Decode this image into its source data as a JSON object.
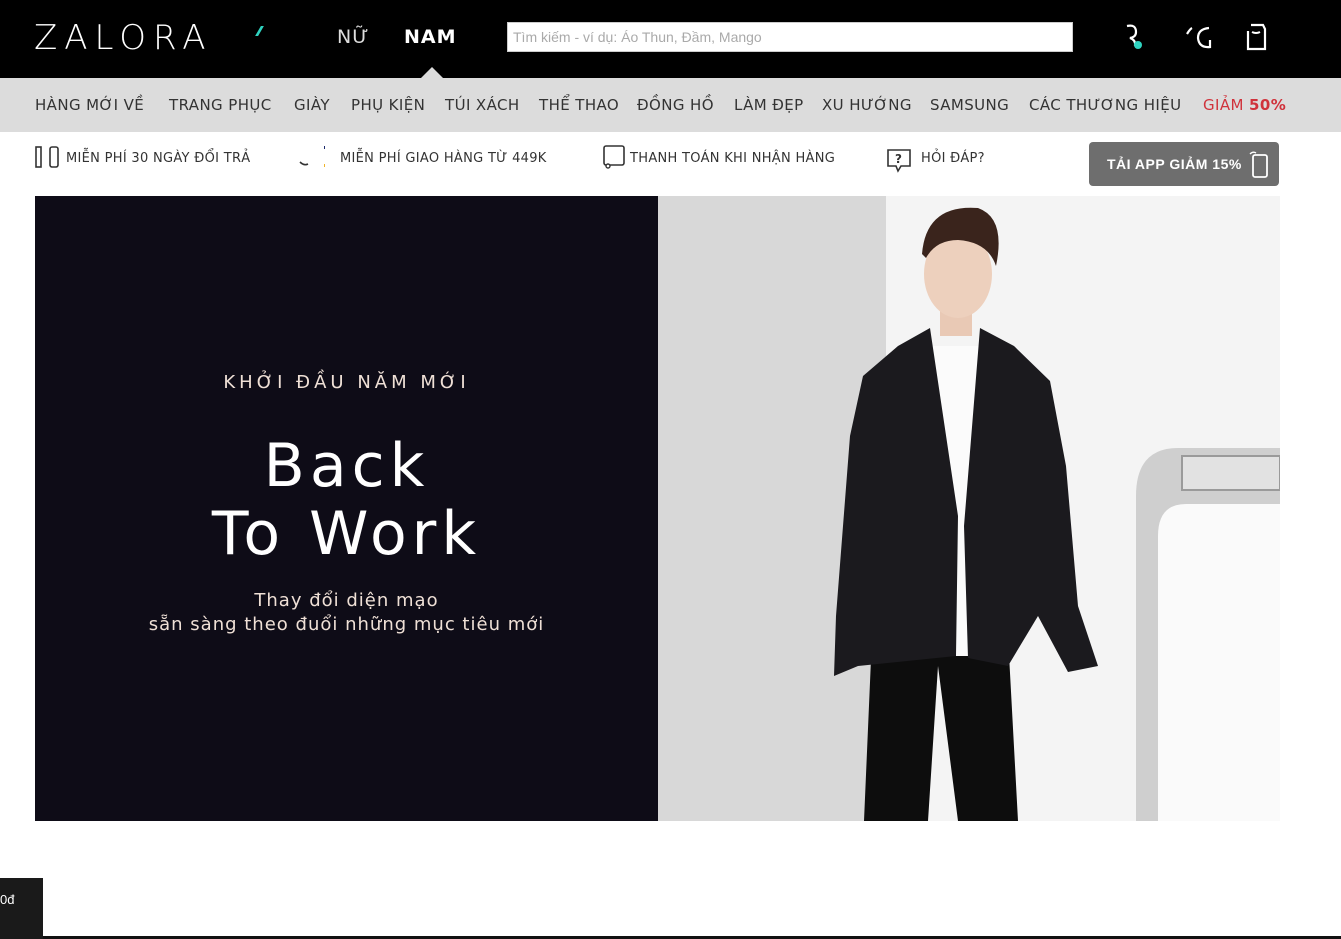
{
  "header": {
    "logo": "ZALORA",
    "gender_women": "NỮ",
    "gender_men": "NAM",
    "search_placeholder": "Tìm kiếm - ví dụ: Áo Thun, Đầm, Mango",
    "icons": [
      "account-icon",
      "wishlist-icon",
      "cart-icon"
    ]
  },
  "categories": [
    {
      "label": "HÀNG MỚI VỀ"
    },
    {
      "label": "TRANG PHỤC"
    },
    {
      "label": "GIÀY"
    },
    {
      "label": "PHỤ KIỆN"
    },
    {
      "label": "TÚI XÁCH"
    },
    {
      "label": "THỂ THAO"
    },
    {
      "label": "ĐỒNG HỒ"
    },
    {
      "label": "LÀM ĐẸP"
    },
    {
      "label": "XU HƯỚNG"
    },
    {
      "label": "SAMSUNG"
    },
    {
      "label": "CÁC THƯƠNG HIỆU"
    }
  ],
  "sale": {
    "label": "GIẢM",
    "value": "50%"
  },
  "services": [
    {
      "label": "MIỄN PHÍ 30 NGÀY ĐỔI TRẢ",
      "icon": "return-icon"
    },
    {
      "label": "MIỄN PHÍ GIAO HÀNG TỪ 449K",
      "icon": "shipping-icon"
    },
    {
      "label": "THANH TOÁN KHI NHẬN HÀNG",
      "icon": "payment-icon"
    },
    {
      "label": "HỎI ĐÁP?",
      "icon": "faq-icon"
    }
  ],
  "app_button": {
    "label": "TẢI APP GIẢM 15%",
    "icon": "phone-icon"
  },
  "banner": {
    "kicker": "KHỞI ĐẦU NĂM MỚI",
    "title_line1": "Back",
    "title_line2": "To Work",
    "sub_line1": "Thay đổi diện mạo",
    "sub_line2": "sẵn sàng theo đuổi những mục tiêu mới"
  },
  "bottom_tab": {
    "text": "0đ"
  },
  "colors": {
    "topbar": "#000000",
    "nav": "#dcdcdc",
    "accent": "#2fd3c0",
    "sale": "#d0323b",
    "banner_left": "#0e0c17"
  }
}
